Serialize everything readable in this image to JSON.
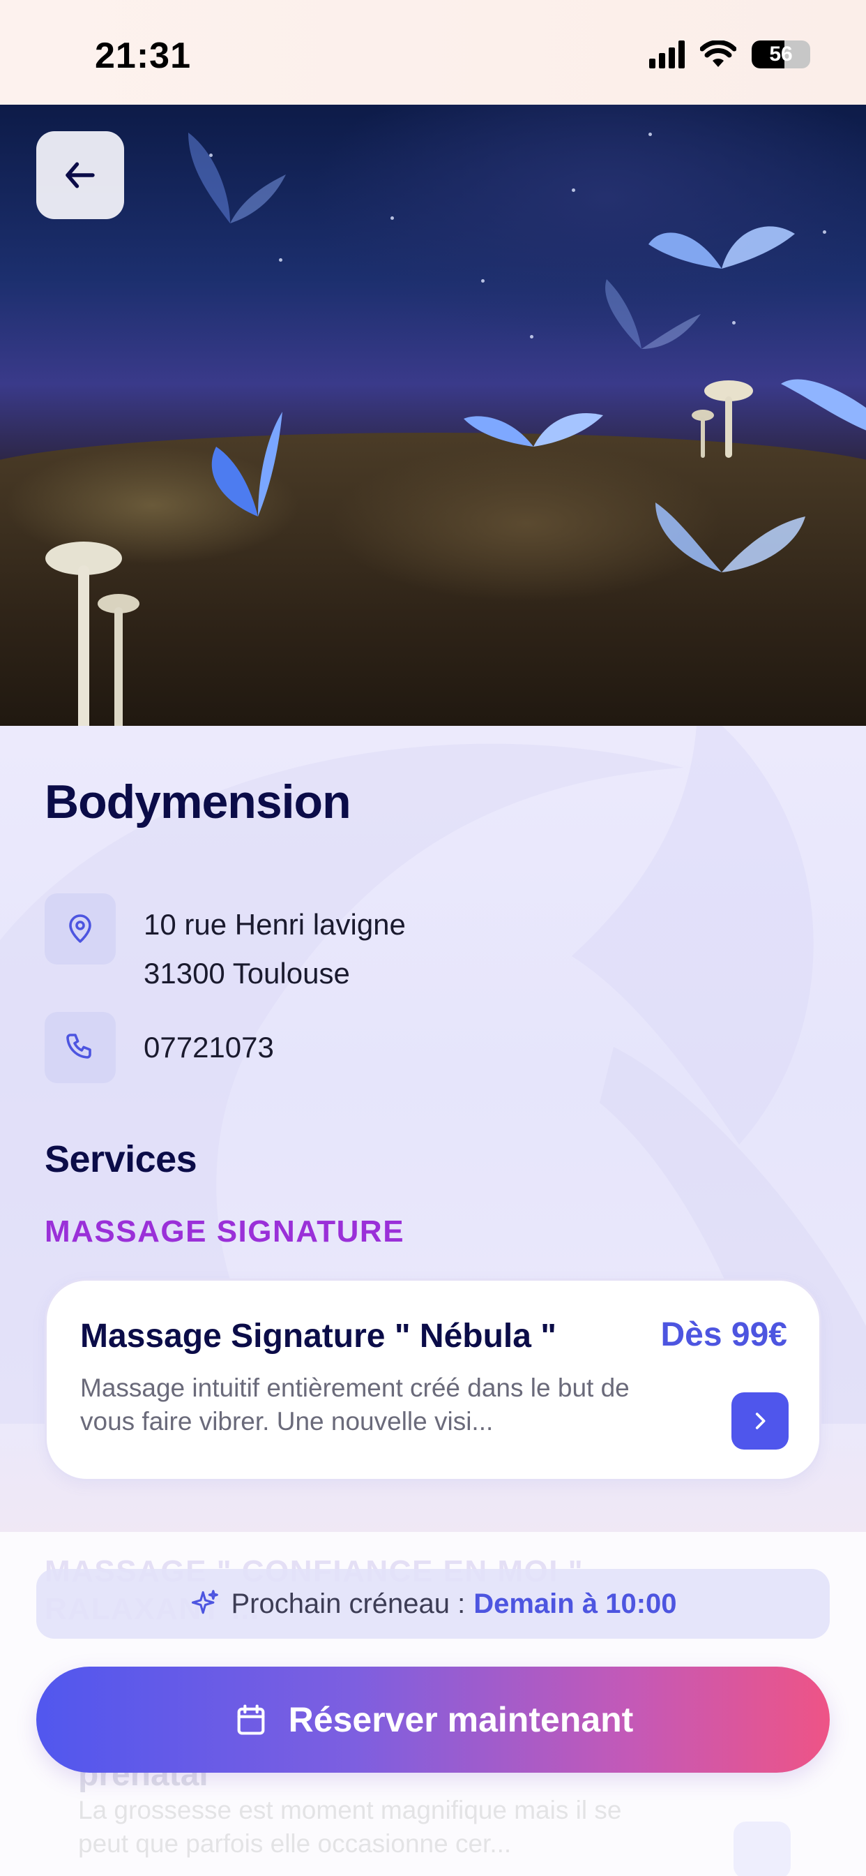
{
  "status_bar": {
    "time": "21:31",
    "battery": "56",
    "battery_level": 0.56
  },
  "header": {
    "back_icon": "arrow-left-icon"
  },
  "business": {
    "name": "Bodymension",
    "address_line1": "10 rue Henri lavigne",
    "address_line2": "31300 Toulouse",
    "phone": "07721073",
    "address_icon": "map-pin-icon",
    "phone_icon": "phone-icon"
  },
  "services": {
    "heading": "Services",
    "categories": [
      {
        "label": "MASSAGE SIGNATURE",
        "items": [
          {
            "title": "Massage Signature \" Nébula \"",
            "price": "Dès 99€",
            "description": "Massage intuitif entièrement créé dans le but de vous faire vibrer. Une nouvelle visi..."
          }
        ]
      },
      {
        "label": "MASSAGE \" CONFIANCE EN MOI \" RALAXANT ...",
        "items": [
          {
            "title": "prénatal",
            "description": "La grossesse est moment magnifique mais il se peut que parfois elle occasionne cer..."
          }
        ]
      }
    ]
  },
  "cta": {
    "next_slot_label": "Prochain créneau :",
    "next_slot_value": "Demain à 10:00",
    "book_label": "Réserver maintenant",
    "sparkle_icon": "sparkle-icon",
    "calendar_icon": "calendar-icon"
  },
  "colors": {
    "brand_dark": "#0b0c48",
    "accent_blue": "#4d55e0",
    "category_purple": "#9a30d8",
    "gradient_start": "#5157ee",
    "gradient_end": "#ee5486"
  }
}
